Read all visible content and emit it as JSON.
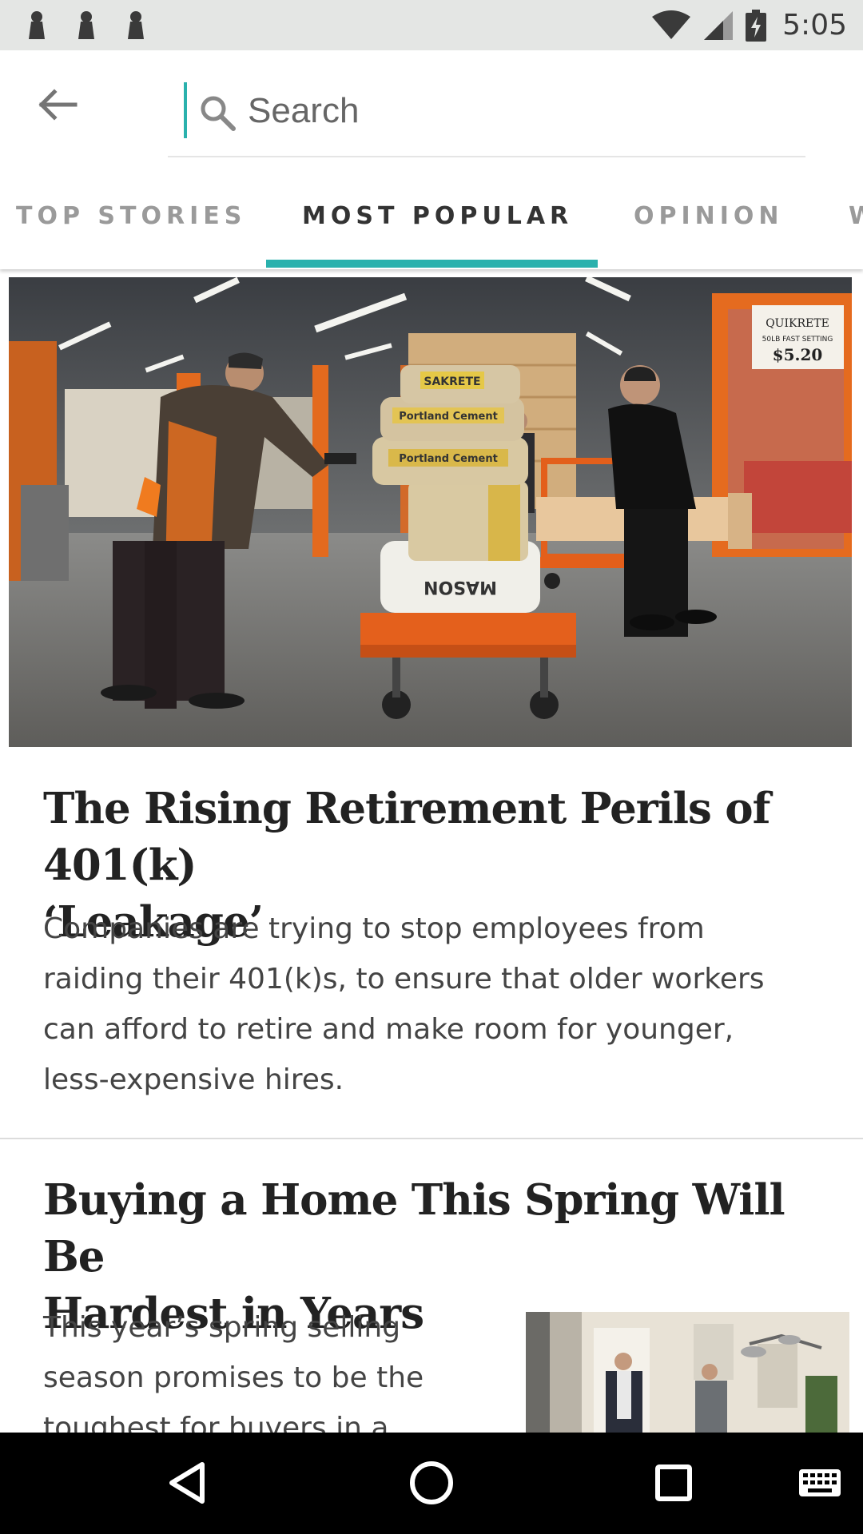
{
  "status_bar": {
    "time": "5:05",
    "notification_icons": [
      "notification-icon",
      "notification-icon",
      "notification-icon"
    ],
    "status_icons": [
      "wifi-icon",
      "cellular-signal-icon",
      "battery-charging-icon"
    ]
  },
  "search": {
    "placeholder": "Search",
    "value": ""
  },
  "tabs": [
    {
      "label": "TOP STORIES",
      "active": false
    },
    {
      "label": "MOST POPULAR",
      "active": true
    },
    {
      "label": "OPINION",
      "active": false
    },
    {
      "label": "W",
      "active": false
    }
  ],
  "articles": [
    {
      "headline_line1": "The Rising Retirement Perils of 401(k)",
      "headline_line2": "‘Leakage’",
      "summary_lines": [
        "Companies are trying to stop employees from",
        "raiding their 401(k)s, to ensure that older workers",
        "can afford to retire and make room for younger,",
        "less-expensive hires."
      ],
      "image": "warehouse-store-photo"
    },
    {
      "headline_line1": "Buying a Home This Spring Will Be",
      "headline_line2": "Hardest in Years",
      "summary_lines": [
        "This year’s spring selling",
        "season promises to be the",
        "toughest for buyers in a"
      ],
      "image": "home-interior-photo"
    }
  ],
  "photo_signage": {
    "sign_brand": "QUIKRETE",
    "sign_text": "50LB FAST SETTING",
    "sign_price": "$5.20",
    "bag_1": "SAKRETE",
    "bag_2": "Portland Cement",
    "bag_3": "Portland Cement",
    "bag_4": "MASON"
  },
  "nav_bar": {
    "buttons": [
      "back-triangle-icon",
      "home-circle-icon",
      "recents-square-icon",
      "keyboard-icon"
    ]
  },
  "colors": {
    "accent": "#2ab1ad",
    "status_bar_bg": "#e4e6e4",
    "nav_bar_bg": "#000000"
  }
}
